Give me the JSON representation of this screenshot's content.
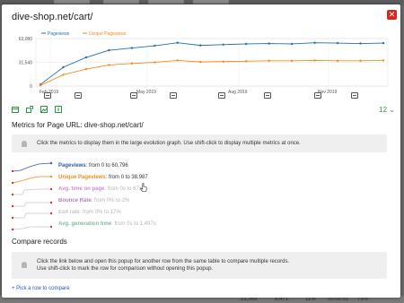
{
  "modal": {
    "title": "dive-shop.net/cart/",
    "close_icon": "close-icon"
  },
  "backdrop_bottom": [
    "31,369",
    "8,471",
    "11%",
    "00:00:51",
    "79%"
  ],
  "chart_data": {
    "type": "line",
    "legend_position": "top-left",
    "x_ticks": [
      "Feb 2019",
      "May 2019",
      "Aug 2019",
      "Nov 2019"
    ],
    "y_ticks": [
      "63,080",
      "31,540",
      "0"
    ],
    "ylim": [
      0,
      63080
    ],
    "grid": true,
    "series": [
      {
        "name": "Pageviews",
        "color": "#1f6fb5",
        "values": [
          2000,
          25000,
          38000,
          47500,
          50500,
          53500,
          57500,
          54000,
          55000,
          56000,
          56500,
          56000,
          57500,
          57000,
          56500,
          57000
        ]
      },
      {
        "name": "Unique Pageviews",
        "color": "#f28a1e",
        "values": [
          800,
          15000,
          22500,
          28000,
          30000,
          31500,
          34000,
          32000,
          32500,
          33000,
          33500,
          33500,
          34000,
          33500,
          33500,
          34000
        ]
      }
    ]
  },
  "toolbar": {
    "period_value": "12"
  },
  "metrics_section": {
    "title": "Metrics for Page URL: dive-shop.net/cart/",
    "hint": "Click the metrics to display them in the large evolution graph. Use shift-click to display multiple metrics at once.",
    "metrics": [
      {
        "name": "Pageviews",
        "range": ": from 0 to 60,796",
        "color": "#2c5fa8",
        "active": true
      },
      {
        "name": "Unique Pageviews",
        "range": ": from 0 to 38,987",
        "color": "#f28a1e",
        "active": true
      },
      {
        "name": "Avg. time on page",
        "range": ": from 0s to 67s",
        "color": "#c86dc9",
        "active": false
      },
      {
        "name": "Bounce Rate",
        "range": ": from 0% to 2%",
        "color": "#a25ca7",
        "active": false
      },
      {
        "name": "Exit rate",
        "range": ": from 0% to 17%",
        "color": "#b4b4b4",
        "active": false
      },
      {
        "name": "Avg. generation time",
        "range": ": from 0s to 1.497s",
        "color": "#6aaa86",
        "active": false
      }
    ]
  },
  "compare_section": {
    "title": "Compare records",
    "hint_line1": "Click the link below and open this popup for another row from the same table to compare multiple records.",
    "hint_line2": "Use shift-click to mark the row for comparison without opening this popup.",
    "link": "+ Pick a row to compare"
  }
}
